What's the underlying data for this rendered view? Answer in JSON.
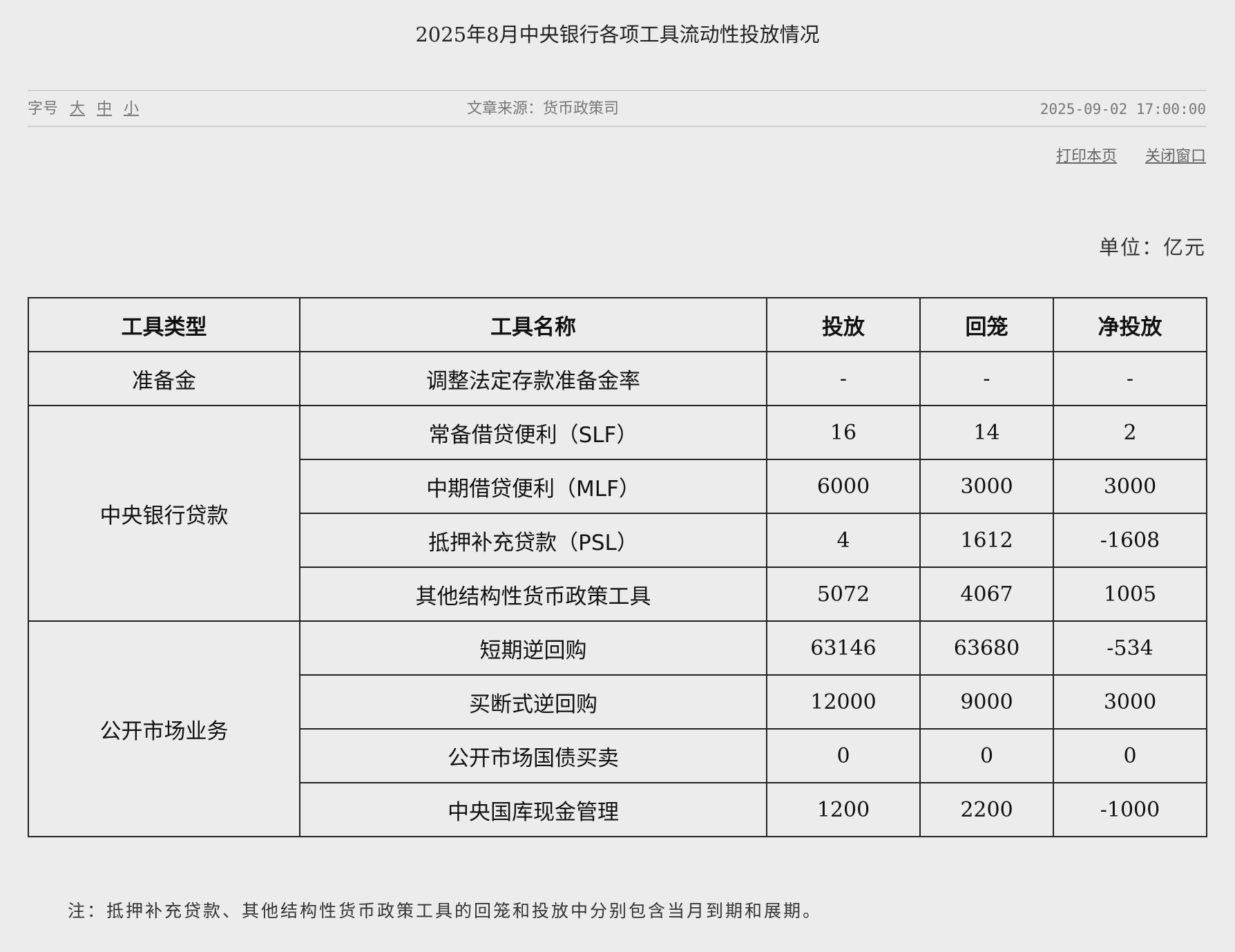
{
  "page": {
    "title": "2025年8月中央银行各项工具流动性投放情况"
  },
  "meta": {
    "font_label": "字号",
    "font_large": "大",
    "font_medium": "中",
    "font_small": "小",
    "source": "文章来源：货币政策司",
    "datetime": "2025-09-02 17:00:00"
  },
  "actions": {
    "print": "打印本页",
    "close": "关闭窗口"
  },
  "unit": "单位：亿元",
  "table": {
    "headers": [
      "工具类型",
      "工具名称",
      "投放",
      "回笼",
      "净投放"
    ],
    "groups": [
      {
        "type": "准备金",
        "rows": [
          {
            "name": "调整法定存款准备金率",
            "release": "-",
            "withdraw": "-",
            "net": "-"
          }
        ]
      },
      {
        "type": "中央银行贷款",
        "rows": [
          {
            "name": "常备借贷便利（SLF）",
            "release": "16",
            "withdraw": "14",
            "net": "2"
          },
          {
            "name": "中期借贷便利（MLF）",
            "release": "6000",
            "withdraw": "3000",
            "net": "3000"
          },
          {
            "name": "抵押补充贷款（PSL）",
            "release": "4",
            "withdraw": "1612",
            "net": "-1608"
          },
          {
            "name": "其他结构性货币政策工具",
            "release": "5072",
            "withdraw": "4067",
            "net": "1005"
          }
        ]
      },
      {
        "type": "公开市场业务",
        "rows": [
          {
            "name": "短期逆回购",
            "release": "63146",
            "withdraw": "63680",
            "net": "-534"
          },
          {
            "name": "买断式逆回购",
            "release": "12000",
            "withdraw": "9000",
            "net": "3000"
          },
          {
            "name": "公开市场国债买卖",
            "release": "0",
            "withdraw": "0",
            "net": "0"
          },
          {
            "name": "中央国库现金管理",
            "release": "1200",
            "withdraw": "2200",
            "net": "-1000"
          }
        ]
      }
    ]
  },
  "note": "注：抵押补充贷款、其他结构性货币政策工具的回笼和投放中分别包含当月到期和展期。"
}
